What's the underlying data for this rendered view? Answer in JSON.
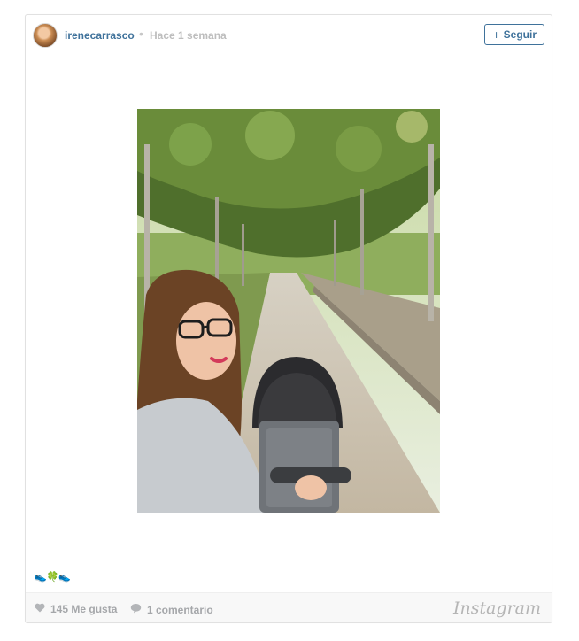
{
  "post": {
    "username": "irenecarrasco",
    "separator": "•",
    "time_ago": "Hace 1 semana",
    "follow_label": "Seguir",
    "follow_plus": "+",
    "caption": "👟🍀👟",
    "likes": "145 Me gusta",
    "comments": "1 comentario",
    "brand": "Instagram"
  },
  "colors": {
    "username": "#3f729b",
    "muted": "#bdbdbd",
    "footer_bg": "#f8f8f8"
  },
  "icons": {
    "like": "heart-icon",
    "comment": "comment-bubble-icon"
  }
}
